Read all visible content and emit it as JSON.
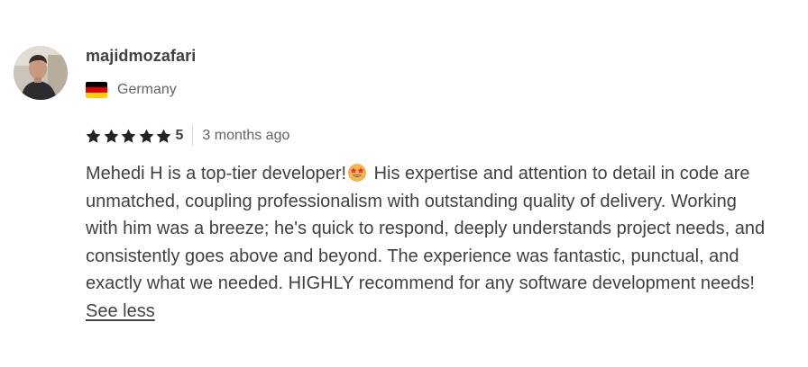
{
  "review": {
    "username": "majidmozafari",
    "country": "Germany",
    "flag_colors": [
      "#000000",
      "#DD0000",
      "#FFCE00"
    ],
    "rating": {
      "stars": 5,
      "value": "5",
      "star_color": "#222325"
    },
    "time_ago": "3 months ago",
    "text_before_emoji": "Mehedi H is a top-tier developer!",
    "emoji": "star-struck-emoji",
    "text_after_emoji": "His expertise and attention to detail in code are unmatched, coupling professionalism with outstanding quality of delivery. Working with him was a breeze; he's quick to respond, deeply understands project needs, and consistently goes above and beyond. The experience was fantastic, punctual, and exactly what we needed. HIGHLY recommend for any software development needs!",
    "see_less_label": "See less"
  }
}
